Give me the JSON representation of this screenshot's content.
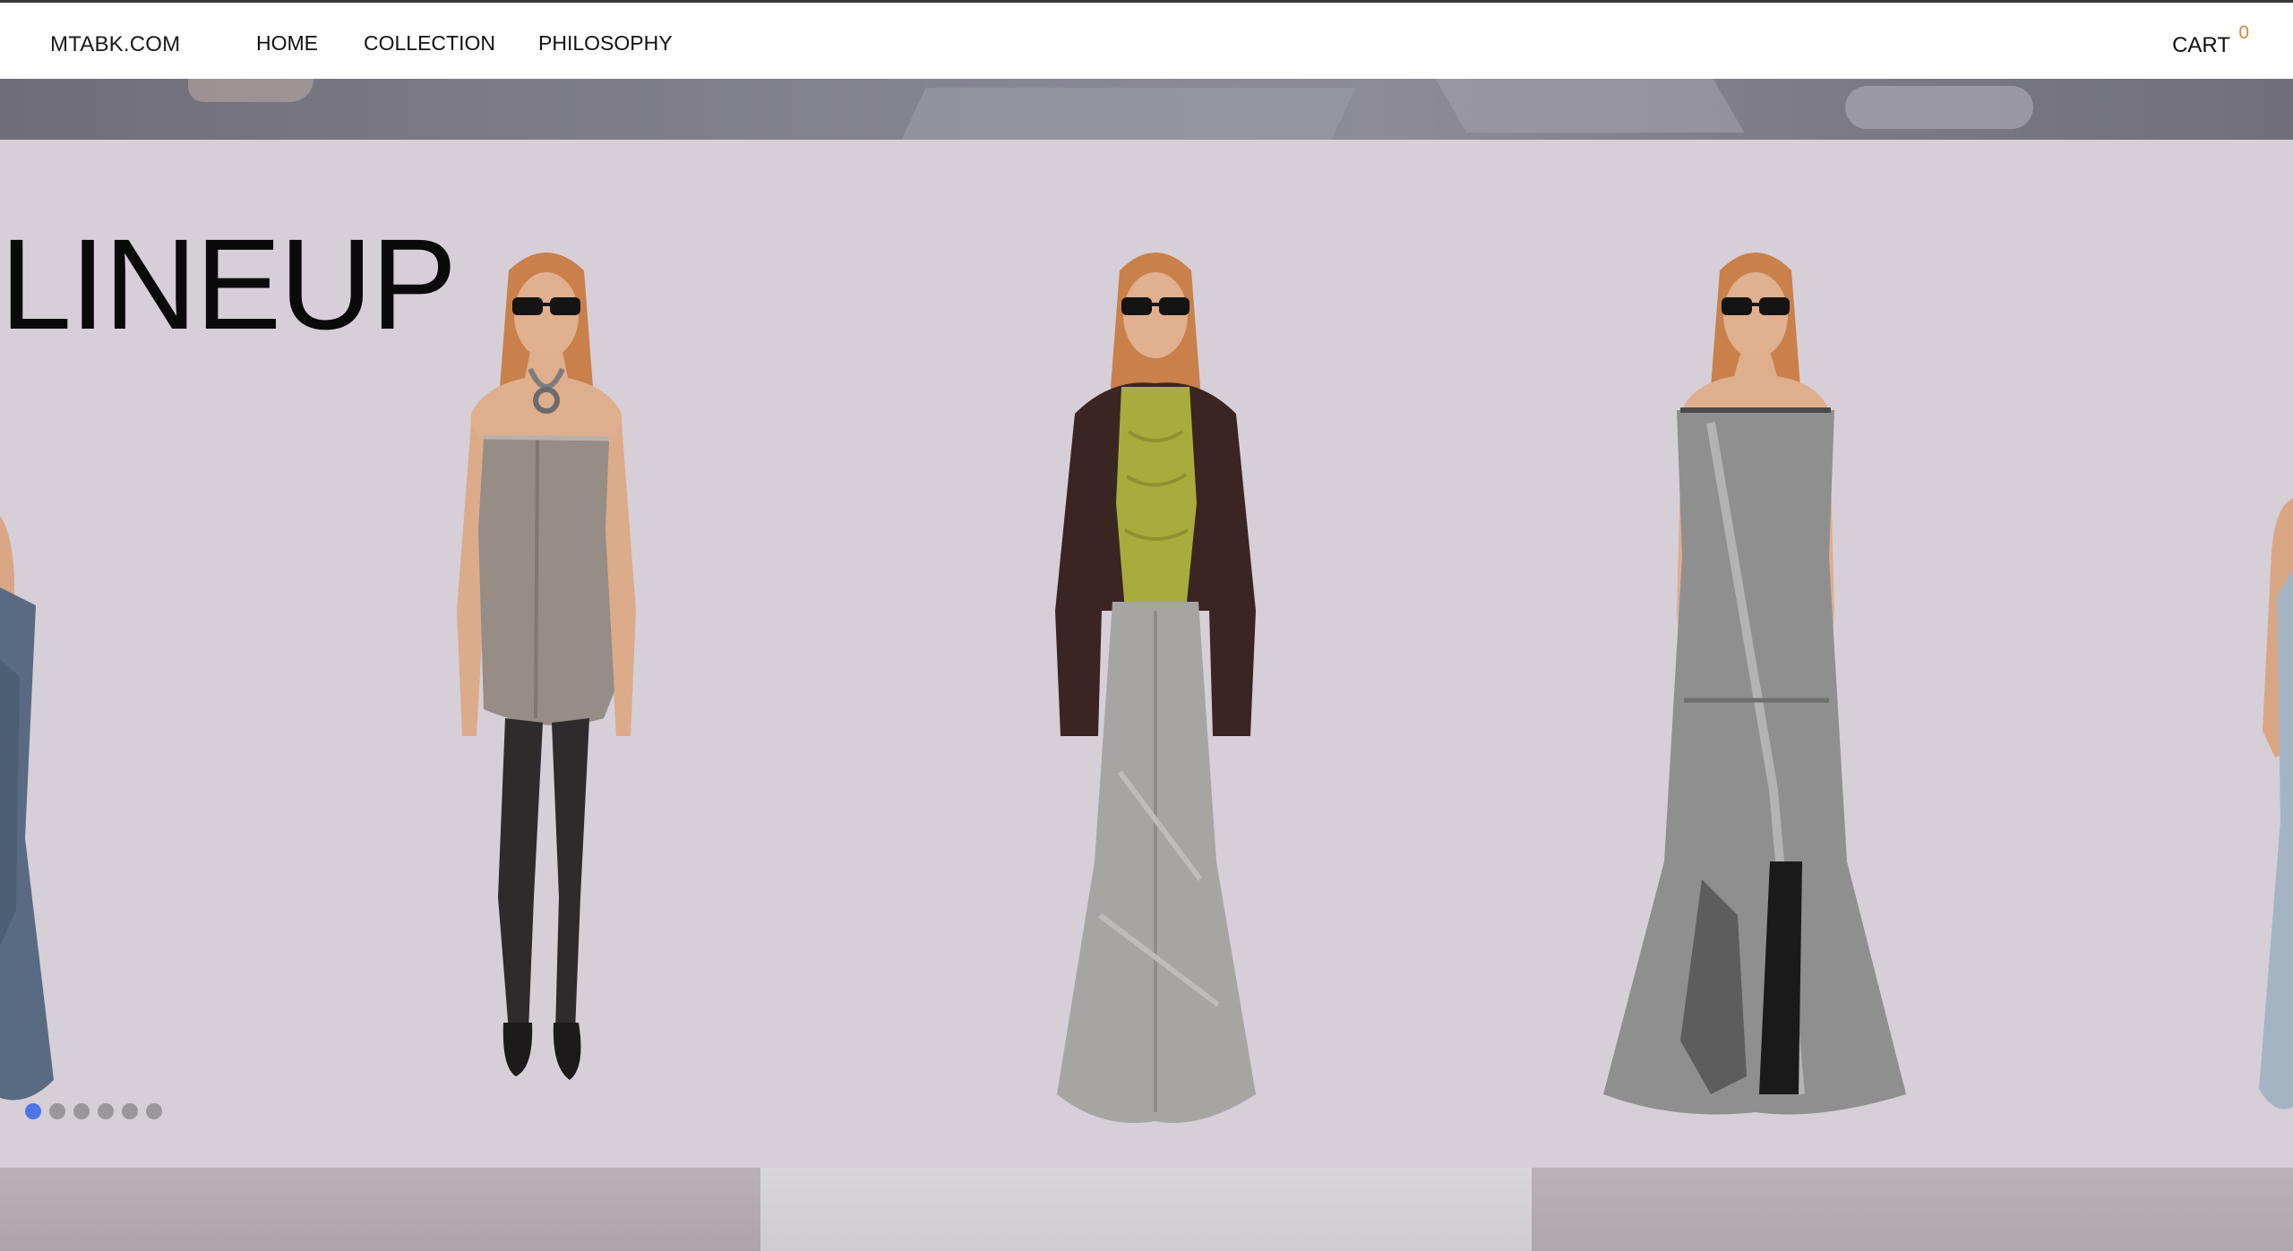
{
  "header": {
    "logo": "MTABK.COM",
    "nav": [
      {
        "label": "HOME"
      },
      {
        "label": "COLLECTION"
      },
      {
        "label": "PHILOSOPHY"
      }
    ],
    "cart_label": "CART",
    "cart_count": "0"
  },
  "lineup": {
    "title": "LINEUP",
    "slides_total": 6,
    "active_slide": 1,
    "colors": {
      "background": "#d6cfd8",
      "active_dot": "#4f74e4",
      "inactive_dot": "#9a969c",
      "cart_count": "#d28a3c"
    },
    "models": [
      {
        "outfit": "denim strapless mini dress with sheer black tights and black pointed flats"
      },
      {
        "outfit": "brown leather jacket, chartreuse ruched top, grey denim maxi skirt"
      },
      {
        "outfit": "grey patchwork denim strapless maxi dress with black knee boots"
      }
    ]
  }
}
